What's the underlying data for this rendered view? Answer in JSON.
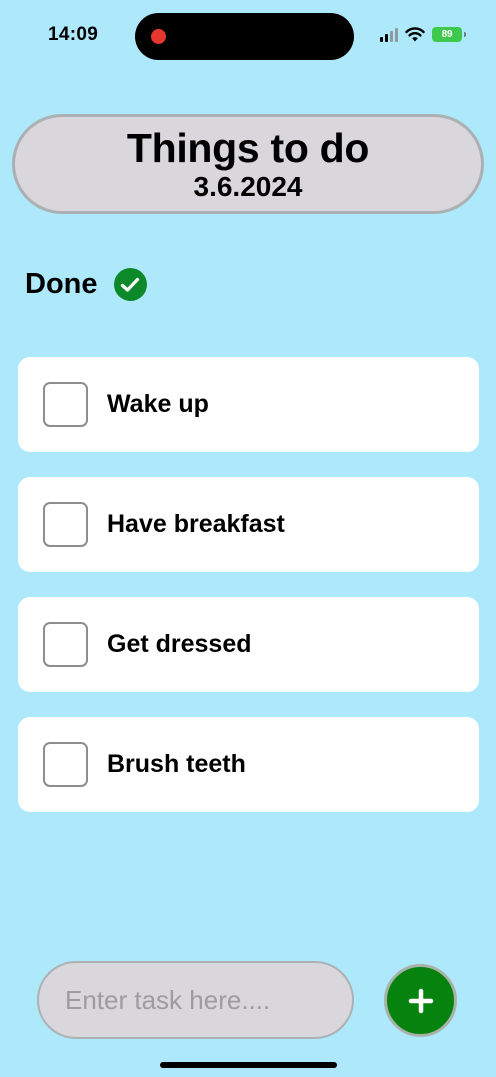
{
  "status_bar": {
    "time": "14:09",
    "battery": "89",
    "icons": [
      "recording-dot-icon",
      "cellular-signal-icon",
      "wifi-icon",
      "battery-charging-icon"
    ]
  },
  "header": {
    "title": "Things to do",
    "date": "3.6.2024"
  },
  "done": {
    "label": "Done",
    "icon": "checkmark-circle-icon",
    "color": "#0c8a2a"
  },
  "tasks": [
    {
      "label": "Wake up",
      "checked": false
    },
    {
      "label": "Have breakfast",
      "checked": false
    },
    {
      "label": "Get dressed",
      "checked": false
    },
    {
      "label": "Brush teeth",
      "checked": false
    }
  ],
  "input": {
    "placeholder": "Enter task here....",
    "value": ""
  },
  "add_button": {
    "icon": "plus-icon",
    "color": "#06820f"
  },
  "colors": {
    "background": "#aee9fb",
    "pill": "#d9d6dc",
    "card": "#ffffff"
  }
}
